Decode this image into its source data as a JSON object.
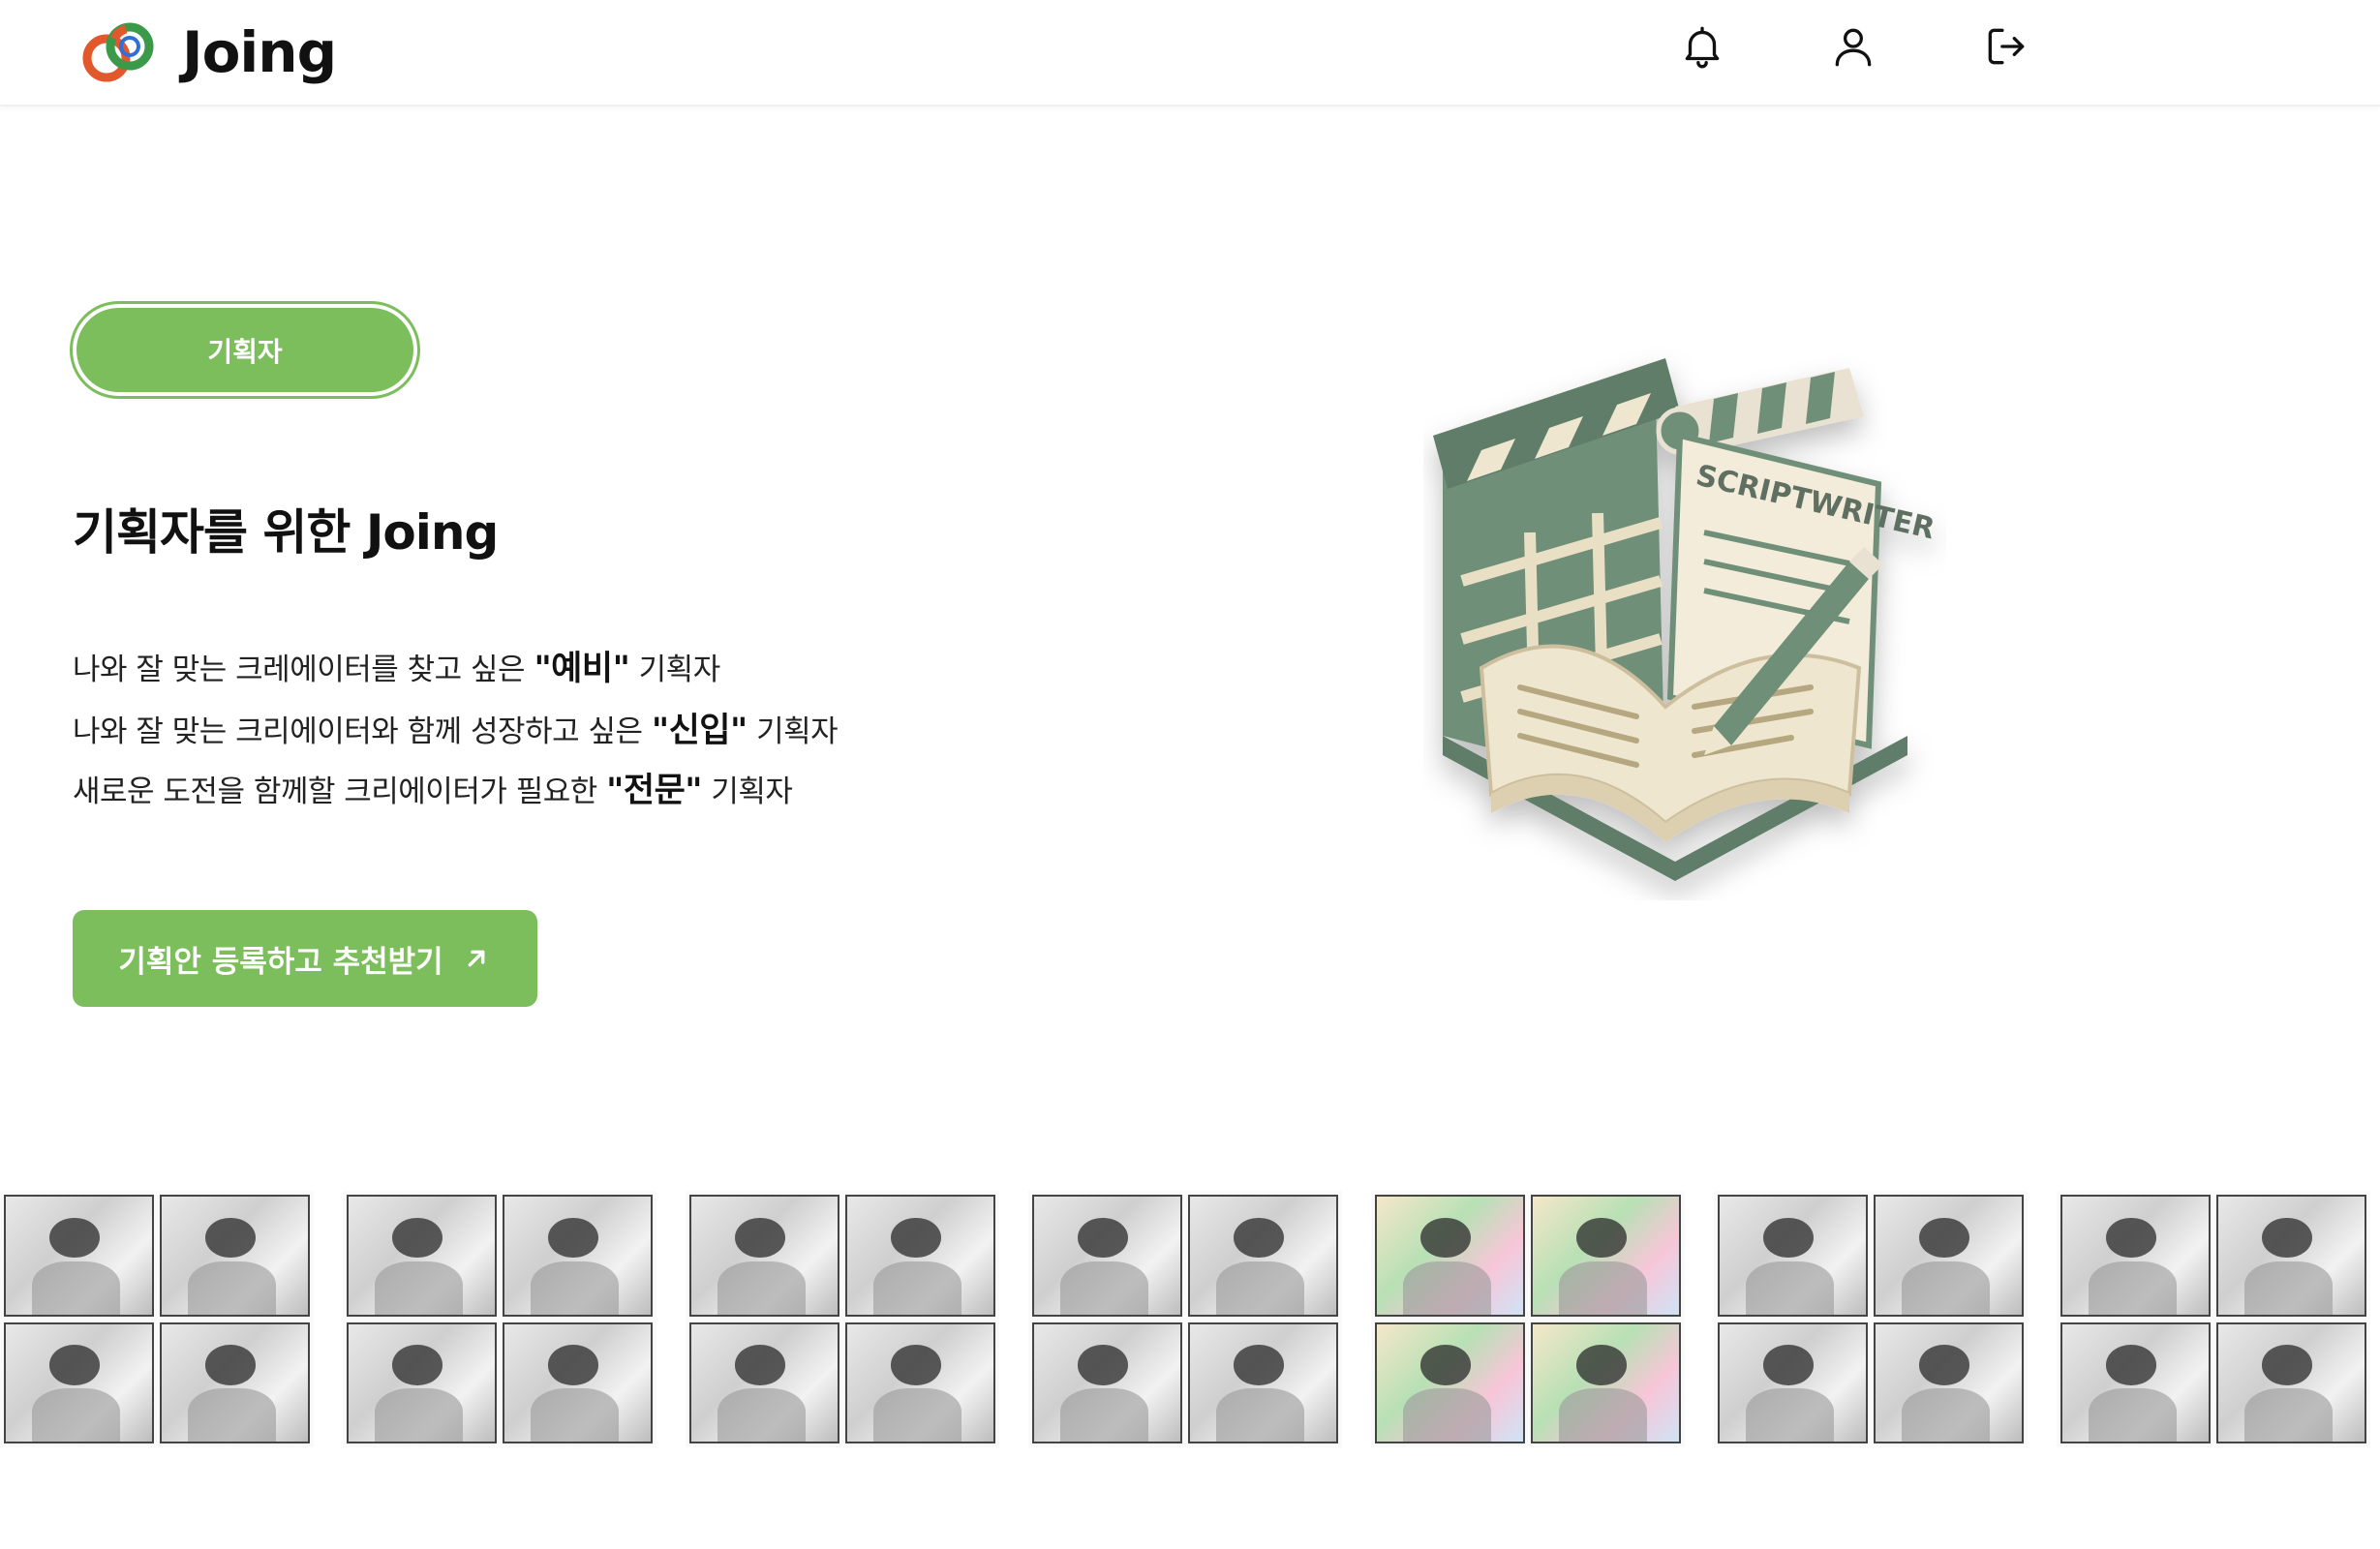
{
  "brand": {
    "name": "Joing"
  },
  "header": {
    "icons": [
      "bell-icon",
      "user-icon",
      "logout-icon"
    ]
  },
  "hero": {
    "badge": "기획자",
    "title": "기획자를 위한 Joing",
    "lines": [
      {
        "pre": "나와 잘 맞는 크레에이터를 찾고 싶은 ",
        "bold": "\"예비\"",
        "post": " 기획자"
      },
      {
        "pre": "나와 잘 맞는 크리에이터와 함께 성장하고 싶은 ",
        "bold": "\"신입\"",
        "post": " 기획자"
      },
      {
        "pre": "새로운 도전을 함께할 크리에이터가 필요한 ",
        "bold": "\"전문\"",
        "post": " 기획자"
      }
    ],
    "cta": "기획안 등록하고 추천받기",
    "illustration_label": "SCRIPTWRITER"
  },
  "colors": {
    "accent": "#7cbd5c",
    "text": "#111111",
    "illustration_green": "#6f8f78",
    "illustration_cream": "#efe6cf"
  },
  "gallery": {
    "tiles": 7,
    "color_tile_index": 4
  }
}
